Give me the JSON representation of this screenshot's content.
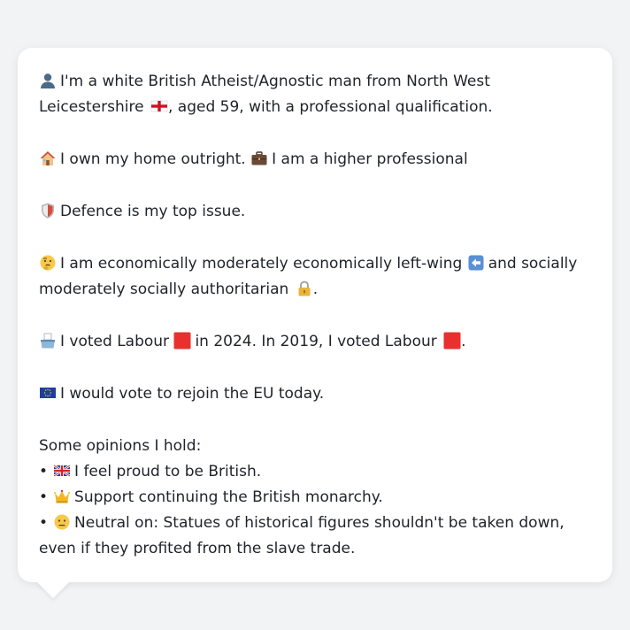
{
  "profile": {
    "intro_text": "I'm a white British Atheist/Agnostic man from North West Leicestershire",
    "intro_text_after_flag": ", aged 59, with a professional qualification.",
    "home_text": "I own my home outright.",
    "job_text": "I am a higher professional",
    "top_issue_text": "Defence is my top issue.",
    "econ_text_a": "I am economically moderately economically left-wing",
    "econ_text_b": "and socially moderately socially authoritarian",
    "econ_text_end": ".",
    "vote_text_a": "I voted Labour",
    "vote_text_b": "in 2024. In 2019, I voted Labour",
    "vote_text_end": ".",
    "eu_text": "I would vote to rejoin the EU today.",
    "opinions_heading": "Some opinions I hold:",
    "opinions": [
      {
        "bullet": "•",
        "text": "I feel proud to be British."
      },
      {
        "bullet": "•",
        "text": "Support continuing the British monarchy."
      },
      {
        "bullet": "•",
        "text": "Neutral on: Statues of historical figures shouldn't be taken down, even if they profited from the slave trade."
      }
    ]
  },
  "icons": {
    "person": "person-silhouette-icon",
    "england_flag": "england-flag-icon",
    "house": "house-icon",
    "briefcase": "briefcase-icon",
    "shield": "shield-icon",
    "thinking": "thinking-face-icon",
    "left_arrow": "left-arrow-icon",
    "padlock": "padlock-icon",
    "ballot": "ballot-box-icon",
    "labour_square": "red-square-icon",
    "eu_flag": "eu-flag-icon",
    "uk_flag": "uk-flag-icon",
    "crown": "crown-icon",
    "neutral_face": "neutral-face-icon"
  },
  "colors": {
    "background": "#f1f3f5",
    "card": "#ffffff",
    "text": "#1f2328",
    "labour_red": "#e8312f"
  }
}
